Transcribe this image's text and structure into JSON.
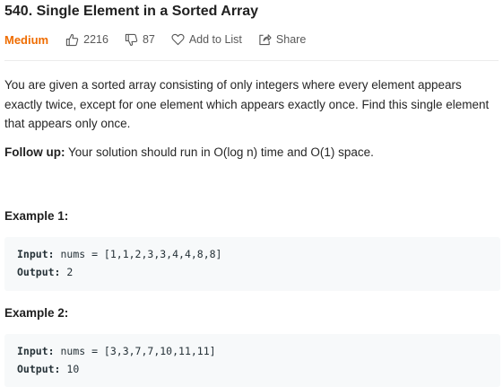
{
  "problem": {
    "title": "540. Single Element in a Sorted Array",
    "difficulty": "Medium",
    "likes": "2216",
    "dislikes": "87",
    "add_to_list_label": "Add to List",
    "share_label": "Share"
  },
  "description": "You are given a sorted array consisting of only integers where every element appears exactly twice, except for one element which appears exactly once. Find this single element that appears only once.",
  "follow_up": {
    "label": "Follow up:",
    "text": " Your solution should run in O(log n) time and O(1) space."
  },
  "examples": [
    {
      "title": "Example 1:",
      "input_label": "Input:",
      "input_value": " nums = [1,1,2,3,3,4,4,8,8]",
      "output_label": "Output:",
      "output_value": " 2"
    },
    {
      "title": "Example 2:",
      "input_label": "Input:",
      "input_value": " nums = [3,3,7,7,10,11,11]",
      "output_label": "Output:",
      "output_value": " 10"
    }
  ],
  "colors": {
    "difficulty_medium": "#ef6c00",
    "code_background": "#f7f9fa"
  }
}
